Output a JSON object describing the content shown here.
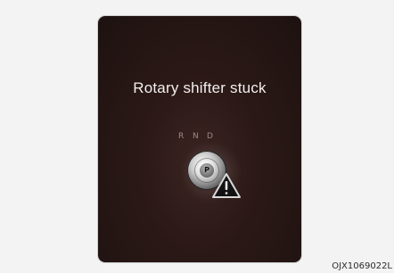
{
  "screen": {
    "message": "Rotary shifter stuck",
    "gear_labels": [
      "R",
      "N",
      "D"
    ],
    "park_label": "P",
    "warning_icon": "warning-triangle-icon",
    "colors": {
      "panel_bg": "#2a1816",
      "text": "#f2efee",
      "gear_text": "#9b8a86"
    }
  },
  "figure": {
    "caption": "OJX1069022L"
  }
}
